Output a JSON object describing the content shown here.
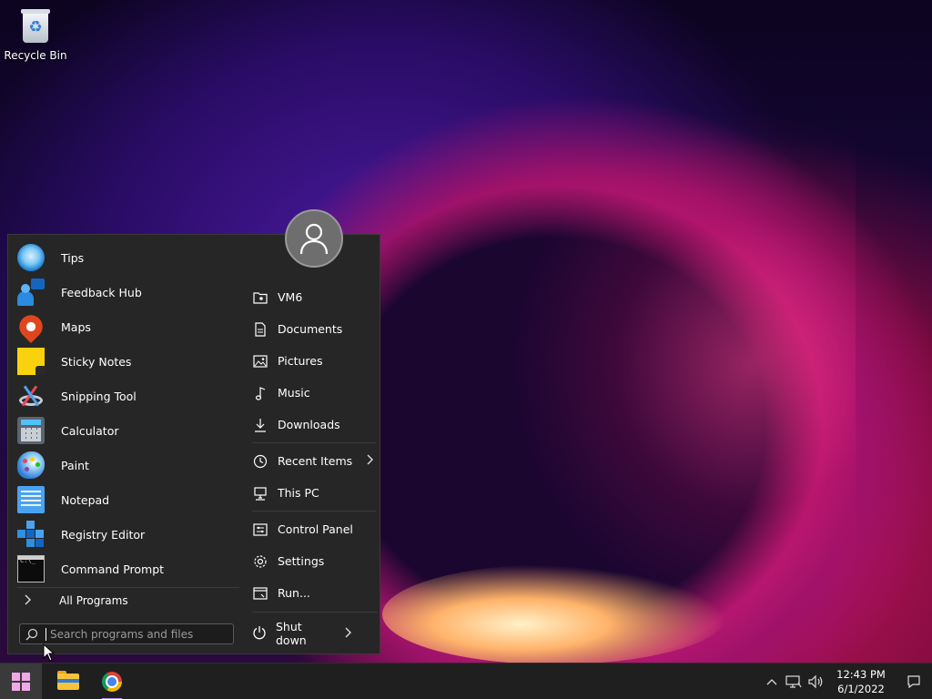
{
  "desktop": {
    "icons": [
      {
        "label": "Recycle Bin",
        "icon": "recycle-bin-icon"
      }
    ]
  },
  "start_menu": {
    "apps": [
      {
        "label": "Tips",
        "icon": "tips-icon"
      },
      {
        "label": "Feedback Hub",
        "icon": "feedback-hub-icon"
      },
      {
        "label": "Maps",
        "icon": "maps-icon"
      },
      {
        "label": "Sticky Notes",
        "icon": "sticky-notes-icon"
      },
      {
        "label": "Snipping Tool",
        "icon": "snipping-tool-icon"
      },
      {
        "label": "Calculator",
        "icon": "calculator-icon"
      },
      {
        "label": "Paint",
        "icon": "paint-icon"
      },
      {
        "label": "Notepad",
        "icon": "notepad-icon"
      },
      {
        "label": "Registry Editor",
        "icon": "registry-editor-icon"
      },
      {
        "label": "Command Prompt",
        "icon": "command-prompt-icon"
      }
    ],
    "all_programs_label": "All Programs",
    "search": {
      "placeholder": "Search programs and files",
      "value": ""
    },
    "places": [
      {
        "label": "VM6",
        "icon": "user-folder-icon"
      },
      {
        "label": "Documents",
        "icon": "document-icon"
      },
      {
        "label": "Pictures",
        "icon": "picture-icon"
      },
      {
        "label": "Music",
        "icon": "music-note-icon"
      },
      {
        "label": "Downloads",
        "icon": "download-icon"
      },
      {
        "label": "Recent Items",
        "icon": "clock-icon",
        "submenu": true
      },
      {
        "label": "This PC",
        "icon": "computer-icon"
      },
      {
        "label": "Control Panel",
        "icon": "control-panel-icon"
      },
      {
        "label": "Settings",
        "icon": "gear-icon"
      },
      {
        "label": "Run...",
        "icon": "run-icon"
      }
    ],
    "shutdown_label": "Shut down"
  },
  "taskbar": {
    "pinned": [
      {
        "name": "start",
        "icon": "windows-logo-icon"
      },
      {
        "name": "file-explorer",
        "icon": "folder-icon"
      },
      {
        "name": "chrome",
        "icon": "chrome-icon",
        "active": true
      }
    ],
    "clock": {
      "time": "12:43 PM",
      "date": "6/1/2022"
    }
  },
  "colors": {
    "menu_bg": "#262626",
    "taskbar_bg": "#1f1f1f",
    "accent": "#f0a8e8"
  }
}
